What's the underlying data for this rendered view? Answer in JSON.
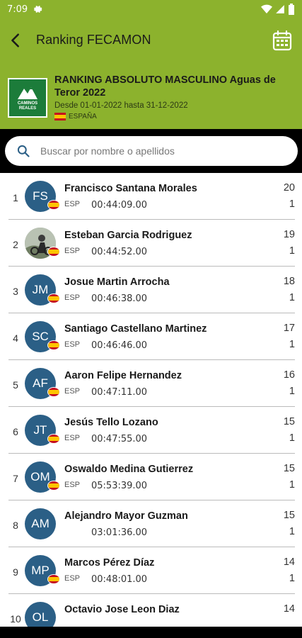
{
  "statusbar": {
    "time": "7:09"
  },
  "appbar": {
    "title": "Ranking FECAMON",
    "back_icon": "arrow-left-icon",
    "calendar_icon": "calendar-icon"
  },
  "header": {
    "title": "RANKING ABSOLUTO MASCULINO Aguas de Teror 2022",
    "dates": "Desde 01-01-2022 hasta 31-12-2022",
    "country": "ESPAÑA",
    "logo_text": "CAMINOS REALES"
  },
  "search": {
    "placeholder": "Buscar por nombre o apellidos",
    "value": ""
  },
  "colors": {
    "primary": "#8cb22d",
    "avatar": "#2b5f86",
    "flag_red": "#c60b1e",
    "flag_yellow": "#ffc400"
  },
  "rows": [
    {
      "rank": "1",
      "initials": "FS",
      "name": "Francisco Santana Morales",
      "country": "ESP",
      "time": "00:44:09.00",
      "points": "20",
      "count": "1"
    },
    {
      "rank": "2",
      "initials": "",
      "name": "Esteban Garcia Rodriguez",
      "country": "ESP",
      "time": "00:44:52.00",
      "points": "19",
      "count": "1",
      "photo": true
    },
    {
      "rank": "3",
      "initials": "JM",
      "name": "Josue Martin Arrocha",
      "country": "ESP",
      "time": "00:46:38.00",
      "points": "18",
      "count": "1"
    },
    {
      "rank": "4",
      "initials": "SC",
      "name": "Santiago Castellano Martinez",
      "country": "ESP",
      "time": "00:46:46.00",
      "points": "17",
      "count": "1"
    },
    {
      "rank": "5",
      "initials": "AF",
      "name": "Aaron Felipe Hernandez",
      "country": "ESP",
      "time": "00:47:11.00",
      "points": "16",
      "count": "1"
    },
    {
      "rank": "6",
      "initials": "JT",
      "name": "Jesús Tello Lozano",
      "country": "ESP",
      "time": "00:47:55.00",
      "points": "15",
      "count": "1"
    },
    {
      "rank": "7",
      "initials": "OM",
      "name": "Oswaldo Medina Gutierrez",
      "country": "ESP",
      "time": "05:53:39.00",
      "points": "15",
      "count": "1"
    },
    {
      "rank": "8",
      "initials": "AM",
      "name": "Alejandro Mayor Guzman",
      "country": "",
      "time": "03:01:36.00",
      "points": "15",
      "count": "1",
      "noflag": true
    },
    {
      "rank": "9",
      "initials": "MP",
      "name": "Marcos Pérez Díaz",
      "country": "ESP",
      "time": "00:48:01.00",
      "points": "14",
      "count": "1"
    },
    {
      "rank": "10",
      "initials": "OL",
      "name": "Octavio Jose Leon Diaz",
      "country": "",
      "time": "",
      "points": "14",
      "count": "",
      "noflag": true
    }
  ]
}
